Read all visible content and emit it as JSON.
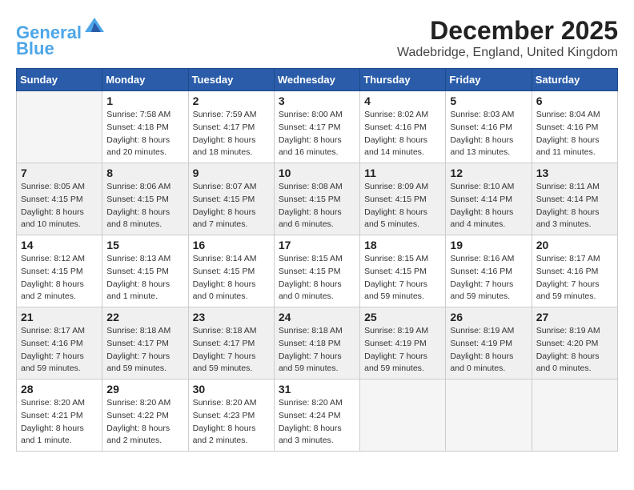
{
  "header": {
    "logo_line1": "General",
    "logo_line2": "Blue",
    "month_title": "December 2025",
    "location": "Wadebridge, England, United Kingdom"
  },
  "weekdays": [
    "Sunday",
    "Monday",
    "Tuesday",
    "Wednesday",
    "Thursday",
    "Friday",
    "Saturday"
  ],
  "weeks": [
    {
      "shaded": false,
      "days": [
        {
          "date": "",
          "info": ""
        },
        {
          "date": "1",
          "info": "Sunrise: 7:58 AM\nSunset: 4:18 PM\nDaylight: 8 hours\nand 20 minutes."
        },
        {
          "date": "2",
          "info": "Sunrise: 7:59 AM\nSunset: 4:17 PM\nDaylight: 8 hours\nand 18 minutes."
        },
        {
          "date": "3",
          "info": "Sunrise: 8:00 AM\nSunset: 4:17 PM\nDaylight: 8 hours\nand 16 minutes."
        },
        {
          "date": "4",
          "info": "Sunrise: 8:02 AM\nSunset: 4:16 PM\nDaylight: 8 hours\nand 14 minutes."
        },
        {
          "date": "5",
          "info": "Sunrise: 8:03 AM\nSunset: 4:16 PM\nDaylight: 8 hours\nand 13 minutes."
        },
        {
          "date": "6",
          "info": "Sunrise: 8:04 AM\nSunset: 4:16 PM\nDaylight: 8 hours\nand 11 minutes."
        }
      ]
    },
    {
      "shaded": true,
      "days": [
        {
          "date": "7",
          "info": "Sunrise: 8:05 AM\nSunset: 4:15 PM\nDaylight: 8 hours\nand 10 minutes."
        },
        {
          "date": "8",
          "info": "Sunrise: 8:06 AM\nSunset: 4:15 PM\nDaylight: 8 hours\nand 8 minutes."
        },
        {
          "date": "9",
          "info": "Sunrise: 8:07 AM\nSunset: 4:15 PM\nDaylight: 8 hours\nand 7 minutes."
        },
        {
          "date": "10",
          "info": "Sunrise: 8:08 AM\nSunset: 4:15 PM\nDaylight: 8 hours\nand 6 minutes."
        },
        {
          "date": "11",
          "info": "Sunrise: 8:09 AM\nSunset: 4:15 PM\nDaylight: 8 hours\nand 5 minutes."
        },
        {
          "date": "12",
          "info": "Sunrise: 8:10 AM\nSunset: 4:14 PM\nDaylight: 8 hours\nand 4 minutes."
        },
        {
          "date": "13",
          "info": "Sunrise: 8:11 AM\nSunset: 4:14 PM\nDaylight: 8 hours\nand 3 minutes."
        }
      ]
    },
    {
      "shaded": false,
      "days": [
        {
          "date": "14",
          "info": "Sunrise: 8:12 AM\nSunset: 4:15 PM\nDaylight: 8 hours\nand 2 minutes."
        },
        {
          "date": "15",
          "info": "Sunrise: 8:13 AM\nSunset: 4:15 PM\nDaylight: 8 hours\nand 1 minute."
        },
        {
          "date": "16",
          "info": "Sunrise: 8:14 AM\nSunset: 4:15 PM\nDaylight: 8 hours\nand 0 minutes."
        },
        {
          "date": "17",
          "info": "Sunrise: 8:15 AM\nSunset: 4:15 PM\nDaylight: 8 hours\nand 0 minutes."
        },
        {
          "date": "18",
          "info": "Sunrise: 8:15 AM\nSunset: 4:15 PM\nDaylight: 7 hours\nand 59 minutes."
        },
        {
          "date": "19",
          "info": "Sunrise: 8:16 AM\nSunset: 4:16 PM\nDaylight: 7 hours\nand 59 minutes."
        },
        {
          "date": "20",
          "info": "Sunrise: 8:17 AM\nSunset: 4:16 PM\nDaylight: 7 hours\nand 59 minutes."
        }
      ]
    },
    {
      "shaded": true,
      "days": [
        {
          "date": "21",
          "info": "Sunrise: 8:17 AM\nSunset: 4:16 PM\nDaylight: 7 hours\nand 59 minutes."
        },
        {
          "date": "22",
          "info": "Sunrise: 8:18 AM\nSunset: 4:17 PM\nDaylight: 7 hours\nand 59 minutes."
        },
        {
          "date": "23",
          "info": "Sunrise: 8:18 AM\nSunset: 4:17 PM\nDaylight: 7 hours\nand 59 minutes."
        },
        {
          "date": "24",
          "info": "Sunrise: 8:18 AM\nSunset: 4:18 PM\nDaylight: 7 hours\nand 59 minutes."
        },
        {
          "date": "25",
          "info": "Sunrise: 8:19 AM\nSunset: 4:19 PM\nDaylight: 7 hours\nand 59 minutes."
        },
        {
          "date": "26",
          "info": "Sunrise: 8:19 AM\nSunset: 4:19 PM\nDaylight: 8 hours\nand 0 minutes."
        },
        {
          "date": "27",
          "info": "Sunrise: 8:19 AM\nSunset: 4:20 PM\nDaylight: 8 hours\nand 0 minutes."
        }
      ]
    },
    {
      "shaded": false,
      "days": [
        {
          "date": "28",
          "info": "Sunrise: 8:20 AM\nSunset: 4:21 PM\nDaylight: 8 hours\nand 1 minute."
        },
        {
          "date": "29",
          "info": "Sunrise: 8:20 AM\nSunset: 4:22 PM\nDaylight: 8 hours\nand 2 minutes."
        },
        {
          "date": "30",
          "info": "Sunrise: 8:20 AM\nSunset: 4:23 PM\nDaylight: 8 hours\nand 2 minutes."
        },
        {
          "date": "31",
          "info": "Sunrise: 8:20 AM\nSunset: 4:24 PM\nDaylight: 8 hours\nand 3 minutes."
        },
        {
          "date": "",
          "info": ""
        },
        {
          "date": "",
          "info": ""
        },
        {
          "date": "",
          "info": ""
        }
      ]
    }
  ]
}
